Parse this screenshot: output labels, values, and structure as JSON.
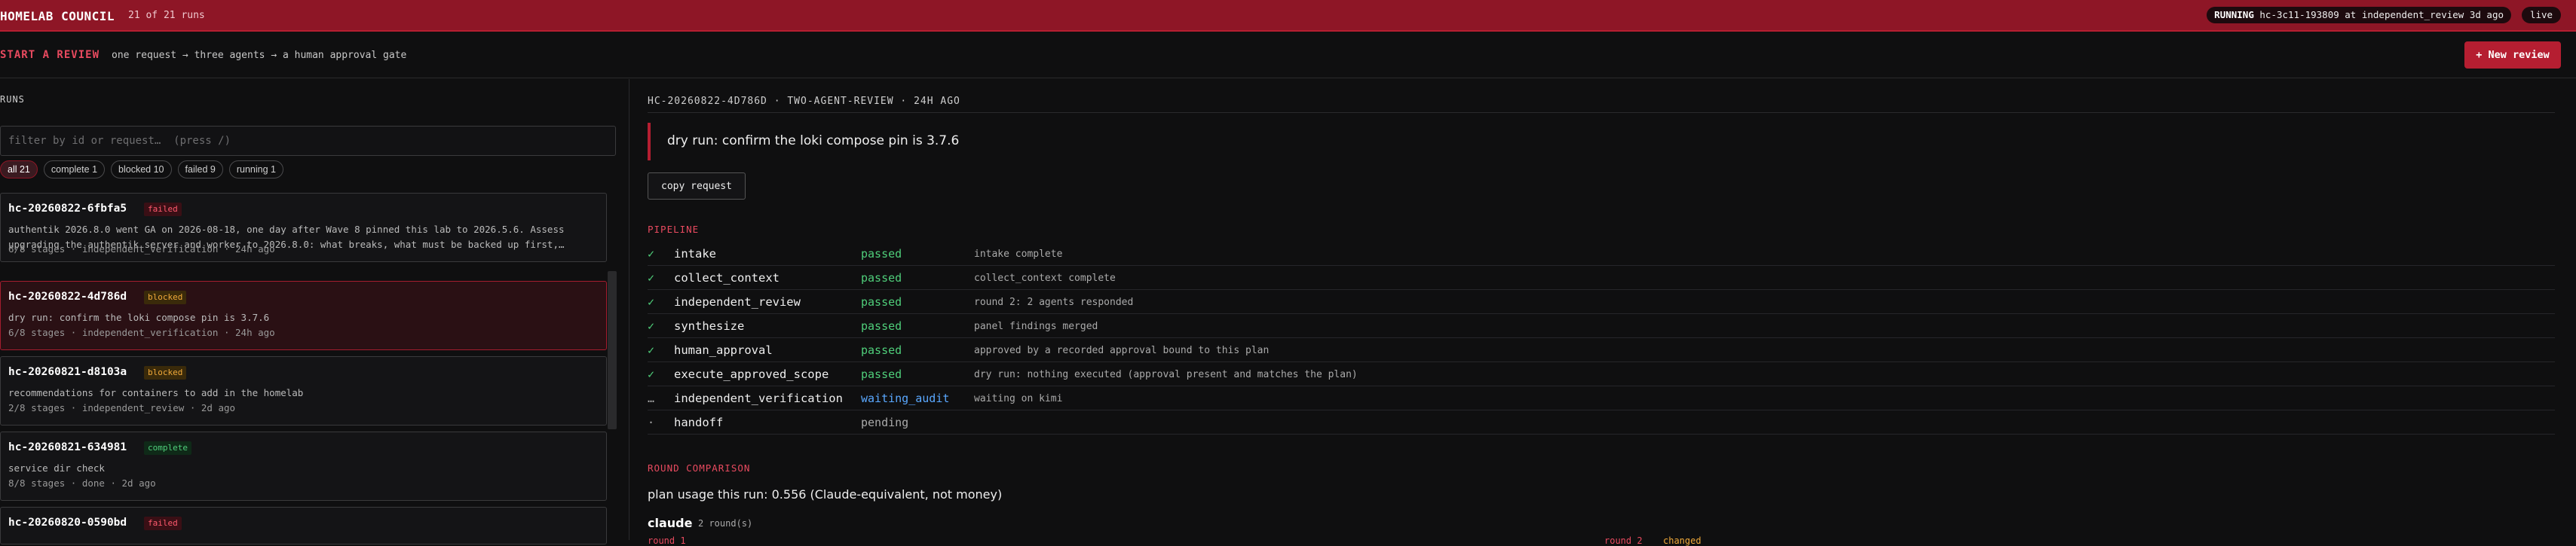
{
  "header": {
    "title": "HOMELAB COUNCIL",
    "run_count": "21 of 21 runs",
    "status_label": "RUNNING",
    "status_detail": "hc-3c11-193809 at independent_review 3d ago",
    "live_label": "live"
  },
  "start": {
    "title": "START A REVIEW",
    "subtitle": "one request → three agents → a human approval gate",
    "new_review_label": "+ New review"
  },
  "runs": {
    "label": "RUNS",
    "filter_placeholder": "filter by id or request…  (press /)",
    "chips": [
      "all 21",
      "complete 1",
      "blocked 10",
      "failed 9",
      "running 1"
    ],
    "cards": [
      {
        "id": "hc-20260822-6fbfa5",
        "status": "failed",
        "desc": "authentik 2026.8.0 went GA on 2026-08-18, one day after Wave 8 pinned this lab to 2026.5.6. Assess upgrading the authentik server and worker to 2026.8.0: what breaks, what must be backed up first,…",
        "meta": "6/8 stages · independent_verification · 24h ago"
      },
      {
        "id": "hc-20260822-4d786d",
        "status": "blocked",
        "desc": "dry run: confirm the loki compose pin is 3.7.6",
        "meta": "6/8 stages · independent_verification · 24h ago"
      },
      {
        "id": "hc-20260821-d8103a",
        "status": "blocked",
        "desc": "recommendations for containers to add in the homelab",
        "meta": "2/8 stages · independent_review · 2d ago"
      },
      {
        "id": "hc-20260821-634981",
        "status": "complete",
        "desc": "service dir check",
        "meta": "8/8 stages · done · 2d ago"
      },
      {
        "id": "hc-20260820-0590bd",
        "status": "failed",
        "desc": "",
        "meta": ""
      }
    ]
  },
  "detail": {
    "header": "HC-20260822-4D786D · TWO-AGENT-REVIEW · 24H AGO",
    "request": "dry run: confirm the loki compose pin is 3.7.6",
    "copy_label": "copy request",
    "pipeline_label": "PIPELINE",
    "stages": [
      {
        "mark": "✓",
        "name": "intake",
        "status": "passed",
        "note": "intake complete"
      },
      {
        "mark": "✓",
        "name": "collect_context",
        "status": "passed",
        "note": "collect_context complete"
      },
      {
        "mark": "✓",
        "name": "independent_review",
        "status": "passed",
        "note": "round 2: 2 agents responded"
      },
      {
        "mark": "✓",
        "name": "synthesize",
        "status": "passed",
        "note": "panel findings merged"
      },
      {
        "mark": "✓",
        "name": "human_approval",
        "status": "passed",
        "note": "approved by a recorded approval bound to this plan"
      },
      {
        "mark": "✓",
        "name": "execute_approved_scope",
        "status": "passed",
        "note": "dry run: nothing executed (approval present and matches the plan)"
      },
      {
        "mark": "…",
        "name": "independent_verification",
        "status": "waiting_audit",
        "note": "waiting on kimi"
      },
      {
        "mark": "·",
        "name": "handoff",
        "status": "pending",
        "note": ""
      }
    ],
    "round_label": "ROUND COMPARISON",
    "plan_usage": "plan usage this run: 0.556 (Claude-equivalent, not money)",
    "agent": {
      "name": "claude",
      "rounds": "2 round(s)",
      "round1": "round 1",
      "round2": "round 2",
      "round2_note": "changed"
    }
  },
  "colors": {
    "brand": "#8e1626",
    "accent": "#e84a5f",
    "passed": "#4fce7a",
    "waiting": "#5aa8ff",
    "blocked": "#f0a93a"
  }
}
